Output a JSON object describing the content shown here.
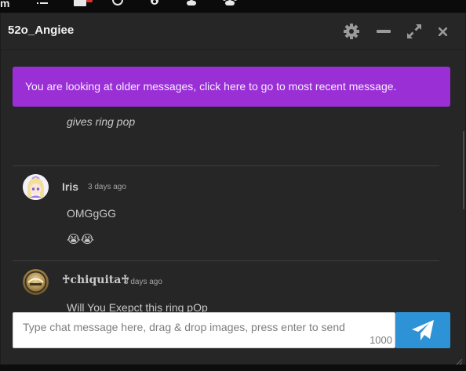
{
  "topbar": {
    "letter": "m",
    "icons": [
      "list-icon",
      "inbox-icon",
      "clock-icon",
      "fire-icon",
      "user-icon",
      "users-icon"
    ]
  },
  "window": {
    "title": "52o_Angiee",
    "controls": [
      "gear-icon",
      "minimize-icon",
      "expand-icon",
      "close-icon"
    ]
  },
  "banner": {
    "text": "You are looking at older messages, click here to go to most recent message."
  },
  "messages": [
    {
      "user": "",
      "time": "",
      "lines": [
        {
          "text": "gives ring pop",
          "italic": true
        }
      ]
    },
    {
      "user": "Iris",
      "time": "3 days ago",
      "lines": [
        {
          "text": "OMGgGG",
          "italic": false
        },
        {
          "text": "😭😭",
          "italic": false
        }
      ]
    },
    {
      "user": "♰chiquita♰",
      "time": "3 days ago",
      "lines": [
        {
          "text": "Will You Exepct this ring pOp",
          "italic": false
        }
      ]
    }
  ],
  "composer": {
    "placeholder": "Type chat message here, drag & drop images, press enter to send",
    "value": "",
    "remaining": "1000"
  },
  "send_button": {
    "icon": "paper-plane-icon"
  },
  "colors": {
    "banner": "#9b2fd6",
    "send": "#2e92d6",
    "panel": "#262626"
  }
}
